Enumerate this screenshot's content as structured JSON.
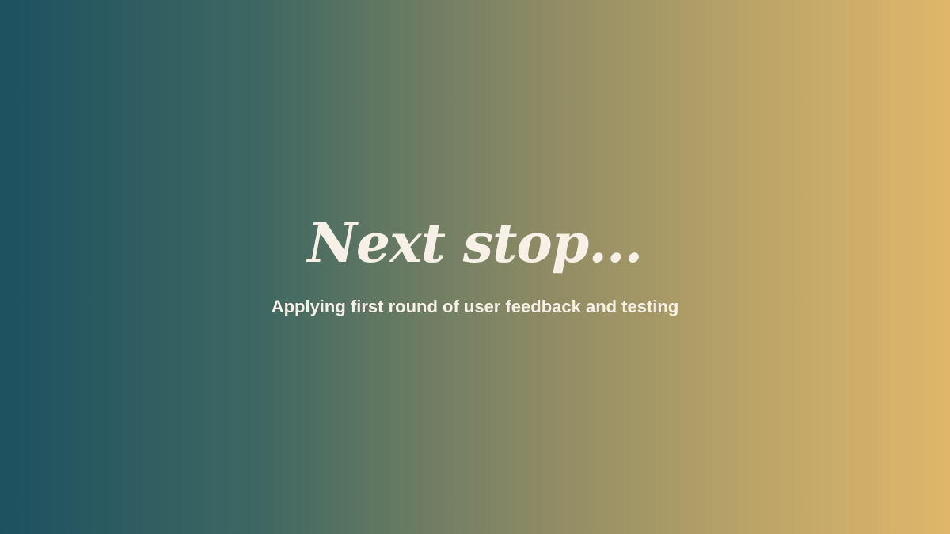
{
  "slide": {
    "title": "Next stop...",
    "subtitle": "Applying first round of user feedback and testing"
  },
  "colors": {
    "gradient_start": "#1d5160",
    "gradient_end": "#e0b66a",
    "text": "#f7f0e7"
  }
}
